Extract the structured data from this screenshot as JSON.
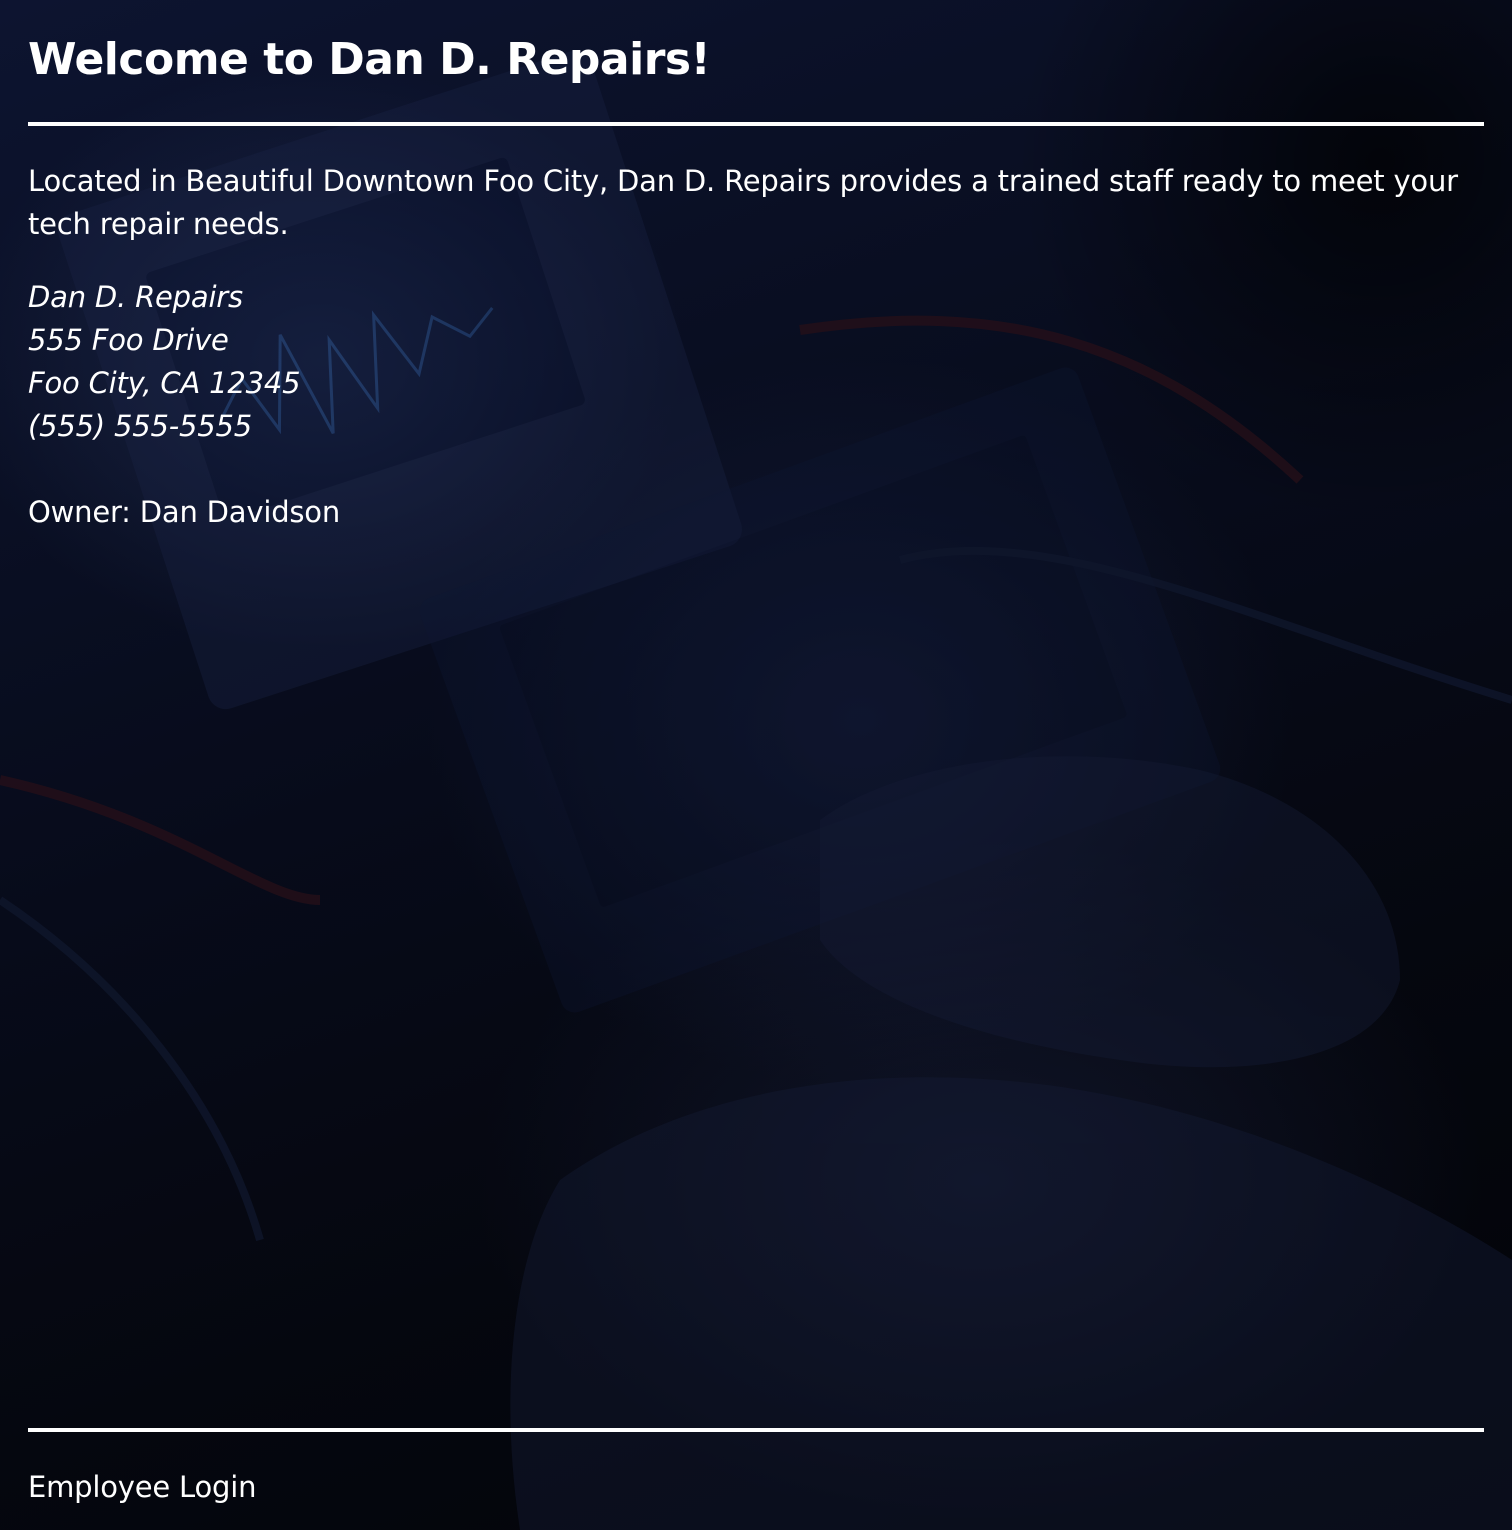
{
  "page": {
    "title": "Welcome to Dan D. Repairs!",
    "intro": "Located in Beautiful Downtown Foo City, Dan D. Repairs provides a trained staff ready to meet your tech repair needs.",
    "address": {
      "name": "Dan D. Repairs",
      "street": "555 Foo Drive",
      "city_state_zip": "Foo City, CA 12345",
      "phone": "(555) 555-5555"
    },
    "owner": "Owner: Dan Davidson"
  },
  "footer": {
    "login_label": "Employee Login"
  },
  "colors": {
    "text": "#ffffff",
    "background": "#05070f",
    "overlay_accent": "#1a2450"
  }
}
